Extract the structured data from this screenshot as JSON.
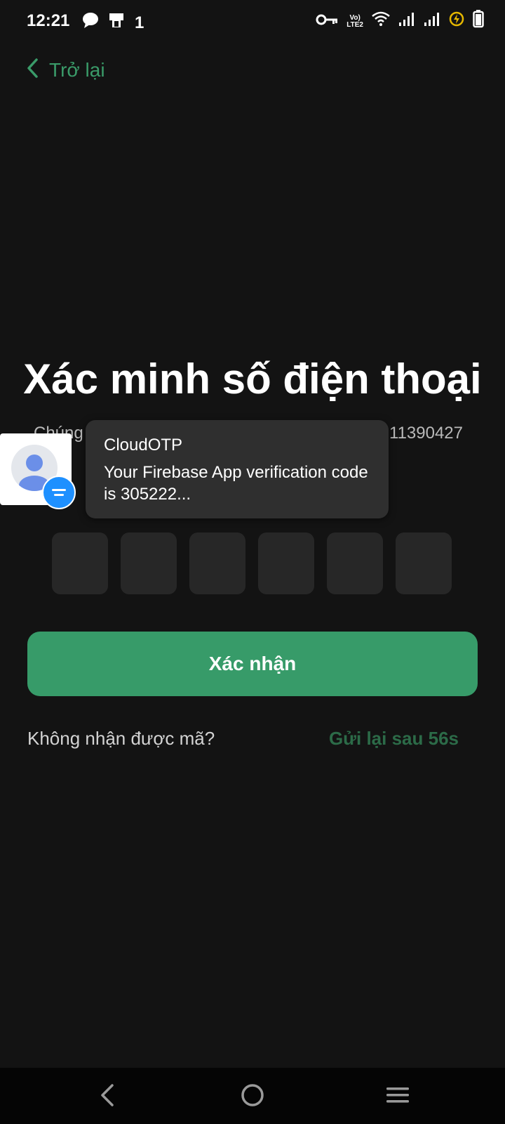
{
  "status_bar": {
    "time": "12:21",
    "network_text_top": "Vo)",
    "network_text_bottom": "LTE2",
    "left_icons": [
      "message-icon",
      "notification-app-icon",
      "data-transfer-icon"
    ],
    "right_icons": [
      "vpn-key-icon",
      "volte-icon",
      "wifi-icon",
      "signal-icon",
      "signal-icon",
      "battery-saver-icon",
      "battery-icon"
    ],
    "data_indicator": "1"
  },
  "header": {
    "back_label": "Trở lại"
  },
  "main": {
    "title": "Xác minh số điện thoại",
    "subtitle_left": "Chúng",
    "subtitle_right": "11390427",
    "otp_length": 6,
    "confirm_label": "Xác nhận",
    "no_code_label": "Không nhận được mã?",
    "resend_label": "Gửi lại sau 56s"
  },
  "notification": {
    "app_name": "CloudOTP",
    "message": "Your Firebase App verification code is 305222..."
  },
  "nav_bar": {
    "icons": [
      "back-triangle-icon",
      "home-circle-icon",
      "menu-icon"
    ]
  },
  "colors": {
    "background": "#131313",
    "accent": "#379b69",
    "resend": "#2c6b48",
    "otp_box": "#272727",
    "notification_bg": "#2f2f2f"
  }
}
